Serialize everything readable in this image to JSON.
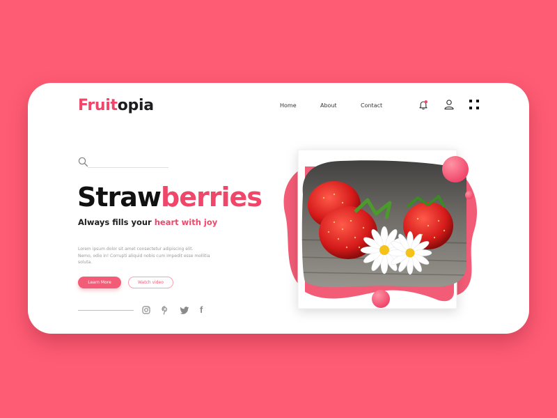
{
  "brand": {
    "part1": "Fruit",
    "part2": "opia"
  },
  "nav": {
    "home": "Home",
    "about": "About",
    "contact": "Contact"
  },
  "icons": {
    "bell": "bell-icon",
    "user": "user-icon",
    "grid": "grid-menu-icon",
    "search": "search-icon",
    "instagram": "instagram-icon",
    "pinterest": "pinterest-icon",
    "twitter": "twitter-icon",
    "facebook": "facebook-icon"
  },
  "hero": {
    "title_part1": "Straw",
    "title_part2": "berries",
    "tagline_part1": "Always fills your ",
    "tagline_part2": "heart with joy",
    "description_line1": "Lorem ipsum dolor sit amet consectetur adipiscing elit.",
    "description_line2": "Nemo, odio in! Corrupti aliquid nobis cum impedit esse mollitia soluta.",
    "primary_button": "Learn More",
    "secondary_button": "Watch video"
  },
  "social": {
    "facebook_glyph": "f"
  },
  "colors": {
    "background": "#fe5c74",
    "accent": "#f0466a",
    "button": "#f25c76",
    "text_dark": "#1d1d1f",
    "card": "#ffffff"
  }
}
